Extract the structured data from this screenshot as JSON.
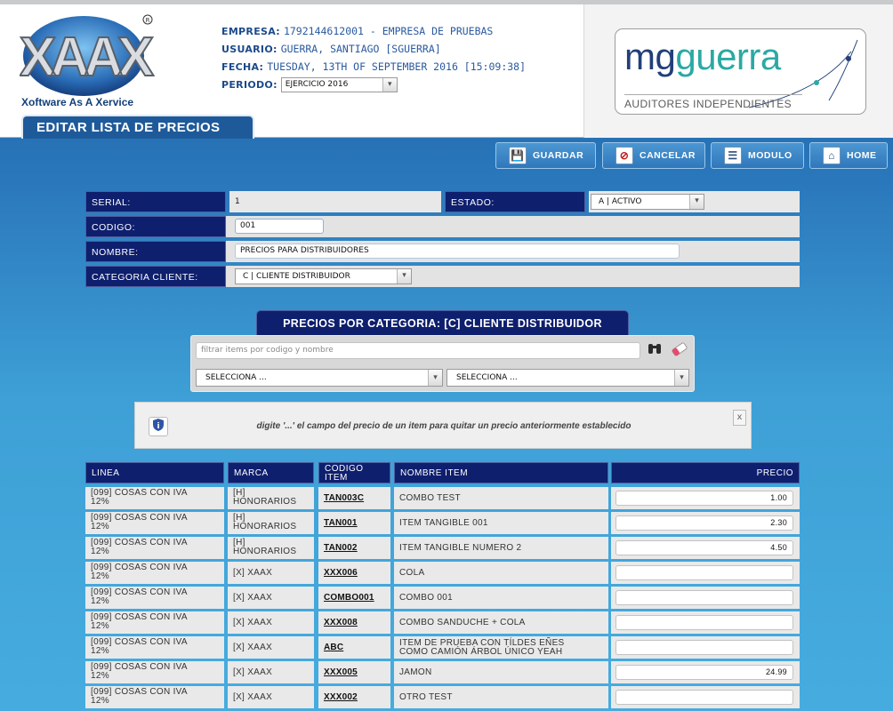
{
  "brand": {
    "name": "Xoftware As A Xervice"
  },
  "header": {
    "empresa_label": "EMPRESA:",
    "empresa_value": "1792144612001 - EMPRESA DE PRUEBAS",
    "usuario_label": "USUARIO:",
    "usuario_value": "GUERRA, SANTIAGO [SGUERRA]",
    "fecha_label": "FECHA:",
    "fecha_value": "TUESDAY, 13TH OF SEPTEMBER 2016 [15:09:38]",
    "periodo_label": "PERIODO:",
    "periodo_value": "EJERCICIO 2016"
  },
  "partner": {
    "name_a": "mg",
    "name_b": "guerra",
    "tagline": "AUDITORES INDEPENDIENTES"
  },
  "page_title": "EDITAR LISTA DE PRECIOS",
  "toolbar": {
    "guardar": "GUARDAR",
    "cancelar": "CANCELAR",
    "modulo": "MODULO",
    "home": "HOME"
  },
  "form": {
    "serial_label": "SERIAL:",
    "serial_value": "1",
    "estado_label": "ESTADO:",
    "estado_value": "A | ACTIVO",
    "codigo_label": "CODIGO:",
    "codigo_value": "001",
    "nombre_label": "NOMBRE:",
    "nombre_value": "PRECIOS PARA DISTRIBUIDORES",
    "categoria_label": "CATEGORIA CLIENTE:",
    "categoria_value": "C | CLIENTE DISTRIBUIDOR"
  },
  "section": {
    "title": "PRECIOS POR CATEGORIA: [C] CLIENTE DISTRIBUIDOR"
  },
  "filter": {
    "placeholder": "filtrar items por codigo y nombre",
    "select1": "SELECCIONA ...",
    "select2": "SELECCIONA ..."
  },
  "notice": {
    "text": "digite '...' el campo del precio de un item para quitar un precio anteriormente establecido",
    "close": "x"
  },
  "table": {
    "columns": {
      "linea": "LINEA",
      "marca": "MARCA",
      "codigo_a": "CODIGO",
      "codigo_b": "ITEM",
      "nombre": "NOMBRE ITEM",
      "precio": "PRECIO"
    },
    "rows": [
      {
        "linea_a": "[099] COSAS CON IVA",
        "linea_b": "12%",
        "marca_a": "[H]",
        "marca_b": "HONORARIOS",
        "codigo": "TAN003C",
        "nombre_a": "COMBO TEST",
        "nombre_b": "",
        "precio": "1.00"
      },
      {
        "linea_a": "[099] COSAS CON IVA",
        "linea_b": "12%",
        "marca_a": "[H]",
        "marca_b": "HONORARIOS",
        "codigo": "TAN001",
        "nombre_a": "ITEM TANGIBLE 001",
        "nombre_b": "",
        "precio": "2.30"
      },
      {
        "linea_a": "[099] COSAS CON IVA",
        "linea_b": "12%",
        "marca_a": "[H]",
        "marca_b": "HONORARIOS",
        "codigo": "TAN002",
        "nombre_a": "ITEM TANGIBLE NUMERO 2",
        "nombre_b": "",
        "precio": "4.50"
      },
      {
        "linea_a": "[099] COSAS CON IVA",
        "linea_b": "12%",
        "marca_a": "[X] XAAX",
        "marca_b": "",
        "codigo": "XXX006",
        "nombre_a": "COLA",
        "nombre_b": "",
        "precio": ""
      },
      {
        "linea_a": "[099] COSAS CON IVA",
        "linea_b": "12%",
        "marca_a": "[X] XAAX",
        "marca_b": "",
        "codigo": "COMBO001",
        "nombre_a": "COMBO 001",
        "nombre_b": "",
        "precio": ""
      },
      {
        "linea_a": "[099] COSAS CON IVA",
        "linea_b": "12%",
        "marca_a": "[X] XAAX",
        "marca_b": "",
        "codigo": "XXX008",
        "nombre_a": "COMBO SANDUCHE + COLA",
        "nombre_b": "",
        "precio": ""
      },
      {
        "linea_a": "[099] COSAS CON IVA",
        "linea_b": "12%",
        "marca_a": "[X] XAAX",
        "marca_b": "",
        "codigo": "ABC",
        "nombre_a": "ITEM DE PRUEBA CON TÍLDES EÑES",
        "nombre_b": "COMO CAMIÓN ÁRBOL ÚNICO YEAH",
        "precio": ""
      },
      {
        "linea_a": "[099] COSAS CON IVA",
        "linea_b": "12%",
        "marca_a": "[X] XAAX",
        "marca_b": "",
        "codigo": "XXX005",
        "nombre_a": "JAMON",
        "nombre_b": "",
        "precio": "24.99"
      },
      {
        "linea_a": "[099] COSAS CON IVA",
        "linea_b": "12%",
        "marca_a": "[X] XAAX",
        "marca_b": "",
        "codigo": "XXX002",
        "nombre_a": "OTRO TEST",
        "nombre_b": "",
        "precio": ""
      }
    ]
  }
}
